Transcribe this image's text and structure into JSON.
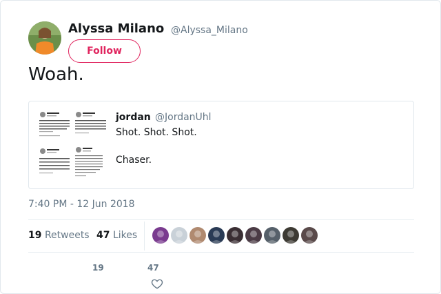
{
  "author": {
    "name": "Alyssa Milano",
    "handle": "@Alyssa_Milano",
    "follow_label": "Follow"
  },
  "tweet": {
    "text": "Woah."
  },
  "quoted_tweet": {
    "name": "jordan",
    "handle": "@JordanUhl",
    "line1": "Shot. Shot. Shot.",
    "line2": "Chaser.",
    "thumbnail_icon": "tweet-screenshots-thumbnail"
  },
  "meta": {
    "timestamp": "7:40 PM - 12 Jun 2018"
  },
  "stats": {
    "retweets_count": "19",
    "retweets_label": "Retweets",
    "likes_count": "47",
    "likes_label": "Likes",
    "liker_colors": [
      "#7a3b8f",
      "#c9d1d8",
      "#b08a70",
      "#2a3b55",
      "#3a2e33",
      "#4b3b45",
      "#56606a",
      "#3d3a33",
      "#5a4a4a"
    ]
  },
  "actions": {
    "retweet_count": "19",
    "like_count": "47",
    "heart_icon": "heart-icon"
  },
  "colors": {
    "accent": "#e0245e",
    "secondary_text": "#657786",
    "primary_text": "#14171a",
    "border": "#e1e8ed"
  }
}
